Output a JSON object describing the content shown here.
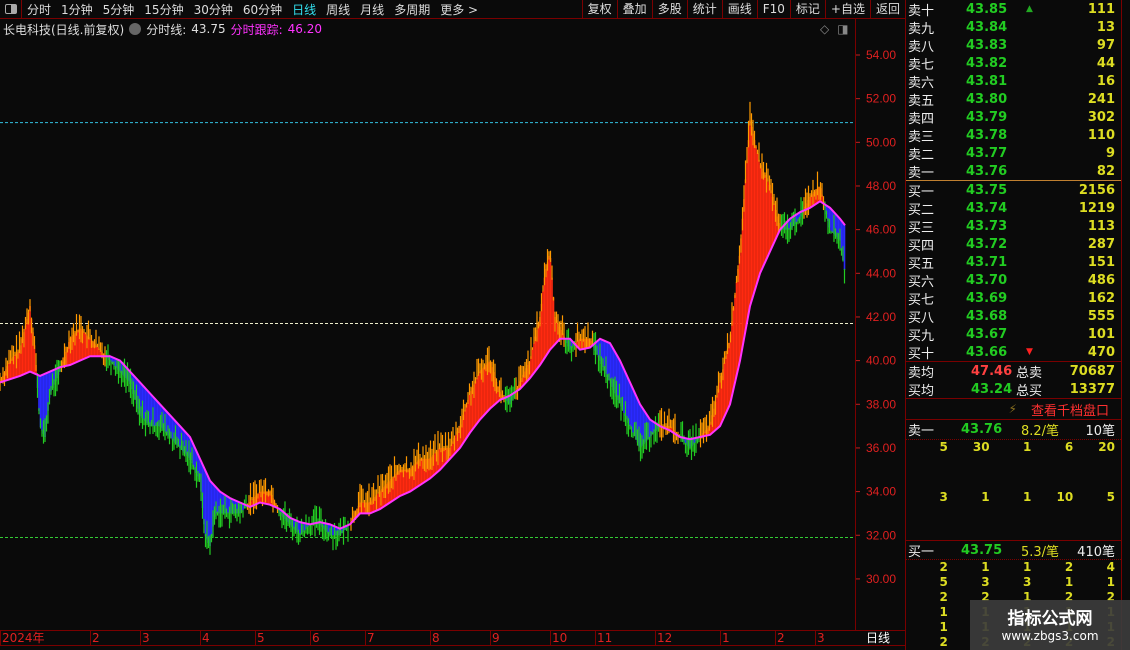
{
  "toolbar": {
    "periods": [
      "分时",
      "1分钟",
      "5分钟",
      "15分钟",
      "30分钟",
      "60分钟",
      "日线",
      "周线",
      "月线",
      "多周期",
      "更多 >"
    ],
    "active": "日线",
    "tools": [
      "复权",
      "叠加",
      "多股",
      "统计",
      "画线",
      "F10",
      "标记",
      "+自选",
      "返回"
    ]
  },
  "info": {
    "title": "长电科技(日线.前复权)",
    "line1_label": "分时线:",
    "line1_value": "43.75",
    "line2_label": "分时跟踪:",
    "line2_value": "46.20"
  },
  "chart_data": {
    "type": "line",
    "title": "长电科技 日线",
    "x_unit": "trading day",
    "ylim": [
      28.5,
      56.5
    ],
    "yticks": [
      30,
      32,
      34,
      36,
      38,
      40,
      42,
      44,
      46,
      48,
      50,
      52,
      54
    ],
    "price": [
      [
        0,
        39
      ],
      [
        2,
        40
      ],
      [
        4,
        40.5
      ],
      [
        6,
        42.5
      ],
      [
        7,
        40.5
      ],
      [
        8,
        37
      ],
      [
        9,
        36.5
      ],
      [
        10,
        38.5
      ],
      [
        12,
        39.5
      ],
      [
        14,
        41
      ],
      [
        16,
        41.5
      ],
      [
        18,
        41
      ],
      [
        20,
        40.5
      ],
      [
        22,
        40
      ],
      [
        24,
        39.5
      ],
      [
        26,
        39
      ],
      [
        28,
        37.5
      ],
      [
        30,
        37
      ],
      [
        32,
        37
      ],
      [
        34,
        36.5
      ],
      [
        36,
        36
      ],
      [
        38,
        35.5
      ],
      [
        40,
        34.5
      ],
      [
        41,
        32
      ],
      [
        42,
        31.5
      ],
      [
        43,
        33
      ],
      [
        44,
        33
      ],
      [
        46,
        33
      ],
      [
        48,
        33
      ],
      [
        50,
        33.5
      ],
      [
        52,
        34
      ],
      [
        54,
        34
      ],
      [
        56,
        33
      ],
      [
        58,
        32.5
      ],
      [
        60,
        32
      ],
      [
        62,
        32.5
      ],
      [
        64,
        32.5
      ],
      [
        66,
        32
      ],
      [
        68,
        32
      ],
      [
        70,
        32.5
      ],
      [
        72,
        33.5
      ],
      [
        74,
        33.5
      ],
      [
        76,
        34
      ],
      [
        78,
        34.5
      ],
      [
        80,
        35
      ],
      [
        82,
        35
      ],
      [
        84,
        35.5
      ],
      [
        86,
        35.5
      ],
      [
        88,
        36
      ],
      [
        90,
        36
      ],
      [
        92,
        37
      ],
      [
        94,
        38.5
      ],
      [
        96,
        39.5
      ],
      [
        98,
        40
      ],
      [
        100,
        38.5
      ],
      [
        102,
        38
      ],
      [
        104,
        39
      ],
      [
        106,
        40
      ],
      [
        108,
        42
      ],
      [
        109,
        44
      ],
      [
        110,
        45
      ],
      [
        111,
        42
      ],
      [
        112,
        41.5
      ],
      [
        114,
        40.5
      ],
      [
        116,
        41
      ],
      [
        118,
        41
      ],
      [
        120,
        40
      ],
      [
        122,
        39
      ],
      [
        124,
        38
      ],
      [
        126,
        37
      ],
      [
        128,
        36
      ],
      [
        130,
        36.5
      ],
      [
        132,
        37
      ],
      [
        134,
        37
      ],
      [
        136,
        36.5
      ],
      [
        138,
        36
      ],
      [
        140,
        36.5
      ],
      [
        142,
        37
      ],
      [
        144,
        39
      ],
      [
        146,
        41
      ],
      [
        148,
        45
      ],
      [
        149,
        48
      ],
      [
        150,
        51
      ],
      [
        151,
        50
      ],
      [
        152,
        49
      ],
      [
        154,
        48
      ],
      [
        156,
        46
      ],
      [
        158,
        46
      ],
      [
        160,
        46.5
      ],
      [
        162,
        47.5
      ],
      [
        164,
        48
      ],
      [
        166,
        46
      ],
      [
        168,
        45.5
      ],
      [
        169,
        44
      ]
    ],
    "ma": [
      [
        0,
        39
      ],
      [
        4,
        39.3
      ],
      [
        6,
        39.5
      ],
      [
        8,
        39.3
      ],
      [
        10,
        39.5
      ],
      [
        12,
        39.7
      ],
      [
        14,
        39.8
      ],
      [
        16,
        40
      ],
      [
        18,
        40.2
      ],
      [
        22,
        40.2
      ],
      [
        24,
        40
      ],
      [
        26,
        39.5
      ],
      [
        28,
        39
      ],
      [
        30,
        38.5
      ],
      [
        32,
        38
      ],
      [
        34,
        37.5
      ],
      [
        36,
        37
      ],
      [
        38,
        36.5
      ],
      [
        40,
        35.5
      ],
      [
        42,
        34.5
      ],
      [
        44,
        34
      ],
      [
        46,
        33.7
      ],
      [
        48,
        33.5
      ],
      [
        50,
        33.3
      ],
      [
        52,
        33.5
      ],
      [
        54,
        33.4
      ],
      [
        56,
        33.2
      ],
      [
        58,
        32.8
      ],
      [
        60,
        32.6
      ],
      [
        62,
        32.5
      ],
      [
        64,
        32.6
      ],
      [
        66,
        32.5
      ],
      [
        68,
        32.3
      ],
      [
        70,
        32.5
      ],
      [
        72,
        33
      ],
      [
        74,
        33
      ],
      [
        76,
        33.2
      ],
      [
        78,
        33.5
      ],
      [
        80,
        33.8
      ],
      [
        82,
        34
      ],
      [
        84,
        34.3
      ],
      [
        86,
        34.6
      ],
      [
        88,
        35
      ],
      [
        90,
        35.5
      ],
      [
        92,
        36
      ],
      [
        94,
        36.7
      ],
      [
        96,
        37.3
      ],
      [
        98,
        37.8
      ],
      [
        100,
        38.2
      ],
      [
        102,
        38.4
      ],
      [
        104,
        38.7
      ],
      [
        106,
        39.2
      ],
      [
        108,
        39.8
      ],
      [
        110,
        40.5
      ],
      [
        112,
        41
      ],
      [
        114,
        41
      ],
      [
        116,
        40.5
      ],
      [
        118,
        40.6
      ],
      [
        120,
        41
      ],
      [
        122,
        40.8
      ],
      [
        124,
        40
      ],
      [
        126,
        39
      ],
      [
        128,
        38
      ],
      [
        130,
        37.3
      ],
      [
        132,
        37
      ],
      [
        134,
        36.8
      ],
      [
        136,
        36.5
      ],
      [
        138,
        36.4
      ],
      [
        140,
        36.5
      ],
      [
        142,
        36.6
      ],
      [
        144,
        37
      ],
      [
        146,
        38
      ],
      [
        148,
        40
      ],
      [
        150,
        42.5
      ],
      [
        152,
        44
      ],
      [
        154,
        45
      ],
      [
        156,
        46
      ],
      [
        158,
        46.5
      ],
      [
        160,
        46.8
      ],
      [
        162,
        47
      ],
      [
        164,
        47.3
      ],
      [
        166,
        47
      ],
      [
        168,
        46.5
      ],
      [
        169,
        46.2
      ]
    ],
    "hlines": [
      {
        "value": 50.9,
        "color": "#33c0e0"
      },
      {
        "value": 41.7,
        "color": "#eeeecc"
      },
      {
        "value": 31.9,
        "color": "#33cc33"
      }
    ],
    "months": [
      {
        "label": "2024年",
        "day": 0
      },
      {
        "label": "2",
        "day": 18
      },
      {
        "label": "3",
        "day": 28
      },
      {
        "label": "4",
        "day": 40
      },
      {
        "label": "5",
        "day": 51
      },
      {
        "label": "6",
        "day": 62
      },
      {
        "label": "7",
        "day": 73
      },
      {
        "label": "8",
        "day": 86
      },
      {
        "label": "9",
        "day": 98
      },
      {
        "label": "10",
        "day": 110
      },
      {
        "label": "11",
        "day": 119
      },
      {
        "label": "12",
        "day": 131
      },
      {
        "label": "1",
        "day": 144
      },
      {
        "label": "2",
        "day": 155
      },
      {
        "label": "3",
        "day": 163
      }
    ],
    "colors": {
      "up_fill": "#ff2a10",
      "down_fill": "#2a2aff",
      "up_line": "#ff9900",
      "down_line": "#22cc22",
      "ma": "#ff33ff"
    }
  },
  "xaxis": {
    "period": "日线"
  },
  "quote": {
    "sell": [
      {
        "label": "卖十",
        "price": "43.85",
        "volume": "111"
      },
      {
        "label": "卖九",
        "price": "43.84",
        "volume": "13"
      },
      {
        "label": "卖八",
        "price": "43.83",
        "volume": "97"
      },
      {
        "label": "卖七",
        "price": "43.82",
        "volume": "44"
      },
      {
        "label": "卖六",
        "price": "43.81",
        "volume": "16"
      },
      {
        "label": "卖五",
        "price": "43.80",
        "volume": "241"
      },
      {
        "label": "卖四",
        "price": "43.79",
        "volume": "302"
      },
      {
        "label": "卖三",
        "price": "43.78",
        "volume": "110"
      },
      {
        "label": "卖二",
        "price": "43.77",
        "volume": "9"
      },
      {
        "label": "卖一",
        "price": "43.76",
        "volume": "82"
      }
    ],
    "buy": [
      {
        "label": "买一",
        "price": "43.75",
        "volume": "2156"
      },
      {
        "label": "买二",
        "price": "43.74",
        "volume": "1219"
      },
      {
        "label": "买三",
        "price": "43.73",
        "volume": "113"
      },
      {
        "label": "买四",
        "price": "43.72",
        "volume": "287"
      },
      {
        "label": "买五",
        "price": "43.71",
        "volume": "151"
      },
      {
        "label": "买六",
        "price": "43.70",
        "volume": "486"
      },
      {
        "label": "买七",
        "price": "43.69",
        "volume": "162"
      },
      {
        "label": "买八",
        "price": "43.68",
        "volume": "555"
      },
      {
        "label": "买九",
        "price": "43.67",
        "volume": "101"
      },
      {
        "label": "买十",
        "price": "43.66",
        "volume": "470"
      }
    ],
    "summary": [
      {
        "label": "卖均",
        "price": "47.46",
        "label2": "总卖",
        "value": "70687"
      },
      {
        "label": "买均",
        "price": "43.24",
        "label2": "总买",
        "value": "13377"
      }
    ],
    "depth_link": "查看千档盘口",
    "sell1": {
      "label": "卖一",
      "price": "43.76",
      "avg": "8.2/笔",
      "count": "10笔",
      "orders": [
        "5",
        "30",
        "1",
        "6",
        "20",
        "3",
        "1",
        "1",
        "10",
        "5"
      ]
    },
    "buy1": {
      "label": "买一",
      "price": "43.75",
      "avg": "5.3/笔",
      "count": "410笔",
      "orders": [
        "2",
        "1",
        "1",
        "2",
        "4",
        "5",
        "3",
        "3",
        "1",
        "1",
        "2",
        "2",
        "1",
        "2",
        "2",
        "1",
        "1",
        "1",
        "1",
        "1",
        "1",
        "1",
        "1",
        "1",
        "1",
        "2",
        "2",
        "2",
        "2",
        "2"
      ]
    }
  },
  "watermark": {
    "title": "指标公式网",
    "url": "www.zbgs3.com"
  }
}
